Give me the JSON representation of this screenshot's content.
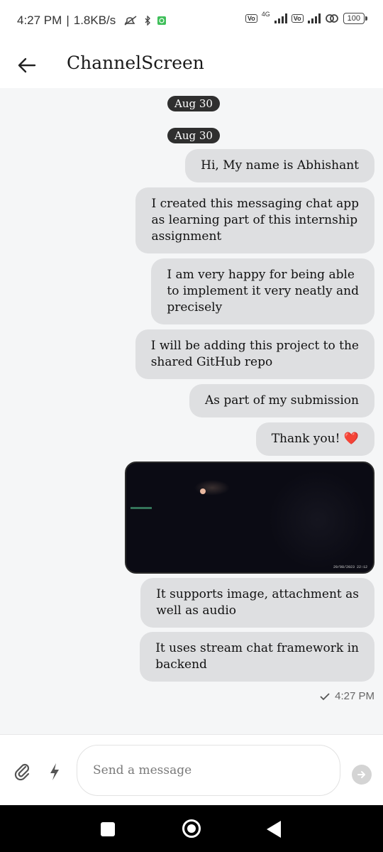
{
  "status_bar": {
    "time": "4:27 PM",
    "separator": "|",
    "speed": "1.8KB/s",
    "network": "4G",
    "volte_1": "Vo LTE",
    "volte_2": "Vo LTE",
    "battery": "100"
  },
  "app_bar": {
    "title": "ChannelScreen"
  },
  "chat": {
    "date_separators": [
      "Aug 30",
      "Aug 30"
    ],
    "messages": [
      {
        "lines": [
          "Hi, My name is Abhishant"
        ]
      },
      {
        "lines": [
          "I created this messaging chat app",
          "as learning part of this internship",
          "assignment"
        ]
      },
      {
        "lines": [
          "I am very happy for being able",
          "to implement it very neatly and",
          "precisely"
        ]
      },
      {
        "lines": [
          "I will be adding this project to the",
          "shared GitHub repo"
        ]
      },
      {
        "lines": [
          "As part of my submission"
        ]
      },
      {
        "lines": [
          "Thank you! ❤️"
        ]
      },
      {
        "lines": [
          "It supports image, attachment as",
          "well as audio"
        ]
      },
      {
        "lines": [
          "It uses stream chat framework in",
          "backend"
        ]
      }
    ],
    "image_stamp": "29/08/2023 22:12",
    "last_time": "4:27 PM"
  },
  "composer": {
    "placeholder": "Send a message"
  }
}
